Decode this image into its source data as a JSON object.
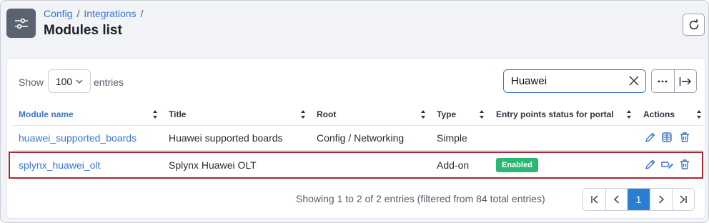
{
  "breadcrumb": [
    "Config",
    "Integrations"
  ],
  "breadcrumb_separator": "/",
  "page_title": "Modules list",
  "toolbar": {
    "show_label": "Show",
    "entries_value": "100",
    "entries_label": "entries",
    "search_value": "Huawei",
    "more_label": "···"
  },
  "table": {
    "headers": [
      "Module name",
      "Title",
      "Root",
      "Type",
      "Entry points status for portal",
      "Actions"
    ],
    "rows": [
      {
        "module": "huawei_supported_boards",
        "title": "Huawei supported boards",
        "root": "Config / Networking",
        "type": "Simple",
        "status": ""
      },
      {
        "module": "splynx_huawei_olt",
        "title": "Splynx Huawei OLT",
        "root": "",
        "type": "Add-on",
        "status": "Enabled"
      }
    ]
  },
  "footer": {
    "info": "Showing 1 to 2 of 2 entries (filtered from 84 total entries)",
    "current_page": "1"
  },
  "colors": {
    "accent": "#3a77c6",
    "badge_enabled": "#2bb673",
    "highlight_border": "#b3262f",
    "pager_active": "#2a7fd4"
  },
  "icons": [
    "settings-sliders-icon",
    "refresh-icon",
    "chevron-down-icon",
    "clear-icon",
    "more-icon",
    "export-icon",
    "sort-icon",
    "edit-icon",
    "grid-icon",
    "trash-icon",
    "tag-edit-icon",
    "first-page-icon",
    "prev-page-icon",
    "next-page-icon",
    "last-page-icon"
  ]
}
